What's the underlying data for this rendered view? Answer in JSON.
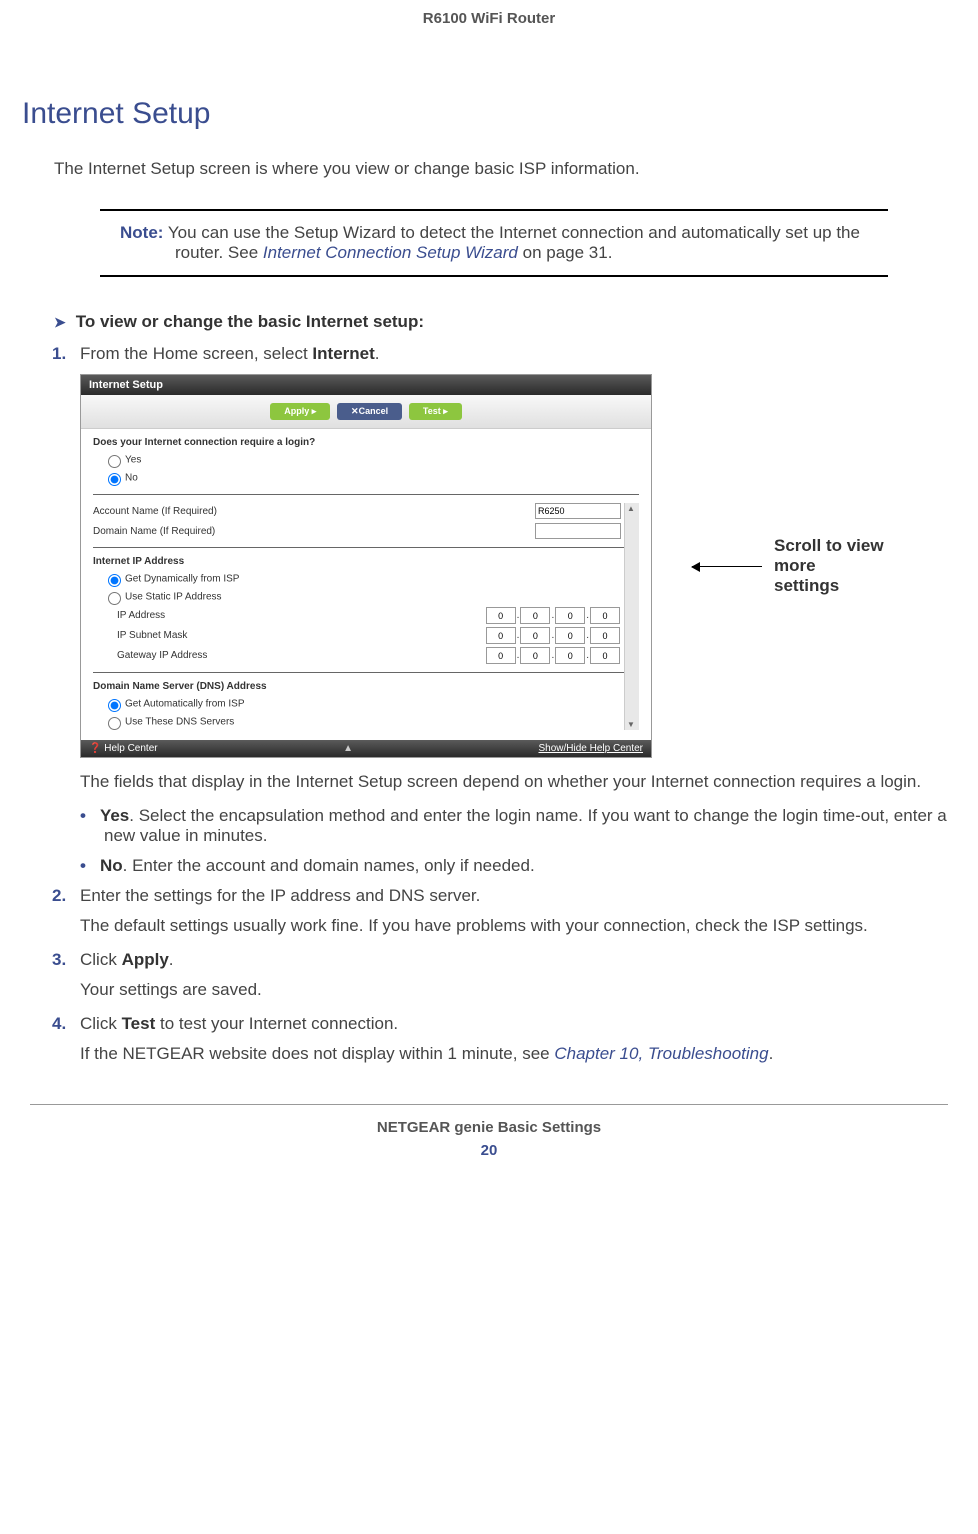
{
  "header": {
    "product": "R6100 WiFi Router"
  },
  "section": {
    "title": "Internet Setup",
    "intro": "The Internet Setup screen is where you view or change basic ISP information."
  },
  "note": {
    "label": "Note:",
    "text_before": "You can use the Setup Wizard to detect the Internet connection and automatically set up the router. See ",
    "link": "Internet Connection Setup Wizard",
    "text_after": " on page 31."
  },
  "procedure": {
    "title": "To view or change the basic Internet setup:",
    "steps": [
      {
        "num": "1.",
        "text_before": "From the Home screen, select ",
        "bold": "Internet",
        "text_after": "."
      },
      {
        "num": "2.",
        "text": "Enter the settings for the IP address and DNS server."
      },
      {
        "num": "3.",
        "text_before": "Click ",
        "bold": "Apply",
        "text_after": "."
      },
      {
        "num": "4.",
        "text_before": "Click ",
        "bold": "Test",
        "text_after": " to test your Internet connection."
      }
    ],
    "after_screenshot": "The fields that display in the Internet Setup screen depend on whether your Internet connection requires a login.",
    "bullets": [
      {
        "bold": "Yes",
        "text": ". Select the encapsulation method and enter the login name. If you want to change the login time-out, enter a new value in minutes."
      },
      {
        "bold": "No",
        "text": ". Enter the account and domain names, only if needed."
      }
    ],
    "step2_followup": "The default settings usually work fine. If you have problems with your connection, check the ISP settings.",
    "step3_followup": "Your settings are saved.",
    "step4_followup_before": "If the NETGEAR website does not display within 1 minute, see ",
    "step4_link": "Chapter 10, Troubleshooting",
    "step4_followup_after": "."
  },
  "screenshot": {
    "title": "Internet Setup",
    "buttons": {
      "apply": "Apply ▸",
      "cancel": "✕Cancel",
      "test": "Test ▸"
    },
    "question": "Does your Internet connection require a login?",
    "radio_yes": "Yes",
    "radio_no": "No",
    "account_label": "Account Name  (If Required)",
    "account_value": "R6250",
    "domain_label": "Domain Name  (If Required)",
    "ip_section": "Internet IP Address",
    "ip_dynamic": "Get Dynamically from ISP",
    "ip_static": "Use Static IP Address",
    "ip_address": "IP Address",
    "ip_subnet": "IP Subnet Mask",
    "ip_gateway": "Gateway IP Address",
    "ip_octets": [
      "0",
      "0",
      "0",
      "0"
    ],
    "dns_section": "Domain Name Server (DNS) Address",
    "dns_auto": "Get Automatically from ISP",
    "dns_static": "Use These DNS Servers",
    "help_left": "❓ Help Center",
    "help_right": "Show/Hide Help Center"
  },
  "annotation": "Scroll to view more settings",
  "footer": {
    "title": "NETGEAR genie Basic Settings",
    "page": "20"
  }
}
